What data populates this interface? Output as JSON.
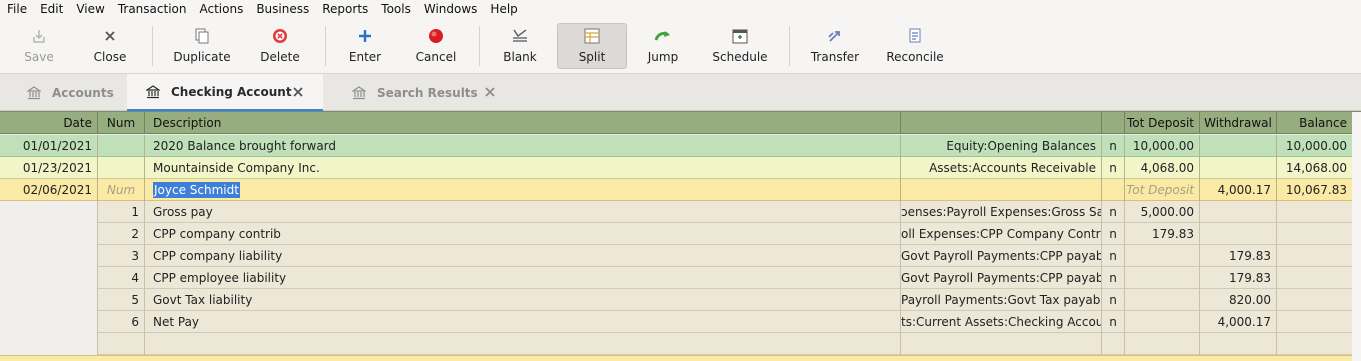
{
  "menu": [
    "File",
    "Edit",
    "View",
    "Transaction",
    "Actions",
    "Business",
    "Reports",
    "Tools",
    "Windows",
    "Help"
  ],
  "toolbar": {
    "save": "Save",
    "close": "Close",
    "duplicate": "Duplicate",
    "delete": "Delete",
    "enter": "Enter",
    "cancel": "Cancel",
    "blank": "Blank",
    "split": "Split",
    "jump": "Jump",
    "schedule": "Schedule",
    "transfer": "Transfer",
    "reconcile": "Reconcile"
  },
  "tabs": [
    {
      "label": "Accounts",
      "icon": "bank-icon",
      "active": false
    },
    {
      "label": "Checking Account",
      "icon": "bank-icon",
      "active": true
    },
    {
      "label": "Search Results",
      "icon": "bank-icon",
      "active": false
    }
  ],
  "register": {
    "headers": {
      "date": "Date",
      "num": "Num",
      "description": "Description",
      "transfer": "",
      "r": "",
      "deposit": "Tot Deposit",
      "withdrawal": "Withdrawal",
      "balance": "Balance"
    },
    "transactions": [
      {
        "date": "01/01/2021",
        "num": "",
        "description": "2020 Balance brought forward",
        "transfer": "Equity:Opening Balances",
        "r": "n",
        "deposit": "10,000.00",
        "withdrawal": "",
        "balance": "10,000.00"
      },
      {
        "date": "01/23/2021",
        "num": "",
        "description": "Mountainside Company Inc.",
        "transfer": "Assets:Accounts Receivable",
        "r": "n",
        "deposit": "4,068.00",
        "withdrawal": "",
        "balance": "14,068.00"
      },
      {
        "date": "02/06/2021",
        "num": "Num",
        "description": "Joyce Schmidt",
        "transfer": "",
        "r": "",
        "deposit": "Tot Deposit",
        "withdrawal": "4,000.17",
        "balance": "10,067.83"
      }
    ],
    "splits": [
      {
        "action": "1",
        "memo": "Gross pay",
        "account": "ɔenses:Payroll Expenses:Gross Salary",
        "r": "n",
        "deposit": "5,000.00",
        "withdrawal": ""
      },
      {
        "action": "2",
        "memo": "CPP company contrib",
        "account": "oll Expenses:CPP Company Contrib",
        "r": "n",
        "deposit": "179.83",
        "withdrawal": ""
      },
      {
        "action": "3",
        "memo": "CPP company liability",
        "account": "Govt Payroll Payments:CPP payable",
        "r": "n",
        "deposit": "",
        "withdrawal": "179.83"
      },
      {
        "action": "4",
        "memo": "CPP employee liability",
        "account": "Govt Payroll Payments:CPP payable",
        "r": "n",
        "deposit": "",
        "withdrawal": "179.83"
      },
      {
        "action": "5",
        "memo": "Govt Tax liability",
        "account": "Payroll Payments:Govt Tax payable",
        "r": "n",
        "deposit": "",
        "withdrawal": "820.00"
      },
      {
        "action": "6",
        "memo": "Net Pay",
        "account": "ts:Current Assets:Checking Account",
        "r": "n",
        "deposit": "",
        "withdrawal": "4,000.17"
      },
      {
        "action": "",
        "memo": "",
        "account": "",
        "r": "",
        "deposit": "",
        "withdrawal": ""
      }
    ]
  }
}
